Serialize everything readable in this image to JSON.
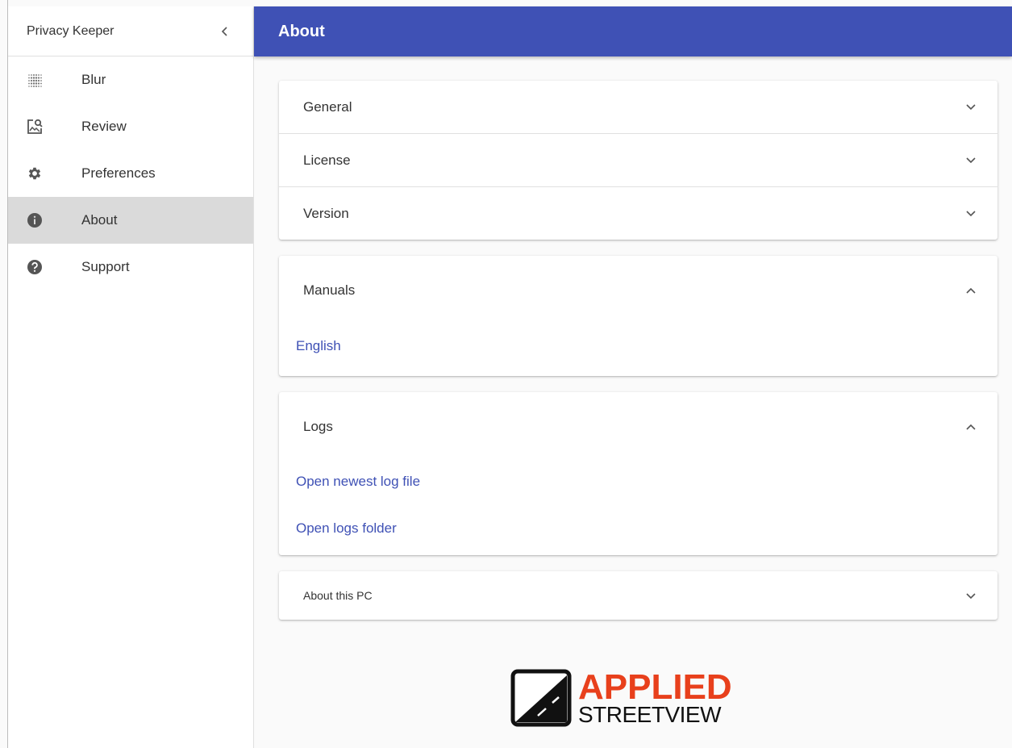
{
  "sidebar": {
    "title": "Privacy Keeper",
    "collapse_glyph": "‹",
    "items": [
      {
        "label": "Blur",
        "icon": "blur-grid-icon"
      },
      {
        "label": "Review",
        "icon": "image-search-icon"
      },
      {
        "label": "Preferences",
        "icon": "gear-icon"
      },
      {
        "label": "About",
        "icon": "info-icon",
        "active": true
      },
      {
        "label": "Support",
        "icon": "help-icon"
      }
    ]
  },
  "topbar": {
    "title": "About",
    "color": "#3f51b5"
  },
  "panels": {
    "general": "General",
    "license": "License",
    "version": "Version",
    "manuals": {
      "title": "Manuals",
      "links": [
        "English"
      ]
    },
    "logs": {
      "title": "Logs",
      "links": [
        "Open newest log file",
        "Open logs folder"
      ]
    },
    "about_pc": "About this PC"
  },
  "logo": {
    "line1": "APPLIED",
    "line2": "STREETVIEW",
    "accent": "#e8401c"
  }
}
